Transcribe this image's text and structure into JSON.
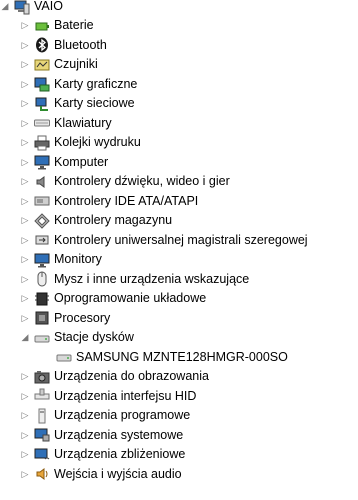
{
  "root": {
    "label": "VAIO",
    "icon": "computer-icon"
  },
  "categories": [
    {
      "label": "Baterie",
      "icon": "battery-icon",
      "expanded": false
    },
    {
      "label": "Bluetooth",
      "icon": "bluetooth-icon",
      "expanded": false
    },
    {
      "label": "Czujniki",
      "icon": "sensor-icon",
      "expanded": false
    },
    {
      "label": "Karty graficzne",
      "icon": "display-adapter-icon",
      "expanded": false
    },
    {
      "label": "Karty sieciowe",
      "icon": "network-adapter-icon",
      "expanded": false
    },
    {
      "label": "Klawiatury",
      "icon": "keyboard-icon",
      "expanded": false
    },
    {
      "label": "Kolejki wydruku",
      "icon": "printer-icon",
      "expanded": false
    },
    {
      "label": "Komputer",
      "icon": "monitor-icon",
      "expanded": false
    },
    {
      "label": "Kontrolery dźwięku, wideo i gier",
      "icon": "speaker-icon",
      "expanded": false
    },
    {
      "label": "Kontrolery IDE ATA/ATAPI",
      "icon": "ide-controller-icon",
      "expanded": false
    },
    {
      "label": "Kontrolery magazynu",
      "icon": "storage-controller-icon",
      "expanded": false
    },
    {
      "label": "Kontrolery uniwersalnej magistrali szeregowej",
      "icon": "usb-icon",
      "expanded": false
    },
    {
      "label": "Monitory",
      "icon": "monitor-icon",
      "expanded": false
    },
    {
      "label": "Mysz i inne urządzenia wskazujące",
      "icon": "mouse-icon",
      "expanded": false
    },
    {
      "label": "Oprogramowanie układowe",
      "icon": "firmware-icon",
      "expanded": false
    },
    {
      "label": "Procesory",
      "icon": "processor-icon",
      "expanded": false
    },
    {
      "label": "Stacje dysków",
      "icon": "disk-drive-icon",
      "expanded": true,
      "children": [
        {
          "label": "SAMSUNG MZNTE128HMGR-000SO",
          "icon": "disk-drive-icon"
        }
      ]
    },
    {
      "label": "Urządzenia do obrazowania",
      "icon": "camera-icon",
      "expanded": false
    },
    {
      "label": "Urządzenia interfejsu HID",
      "icon": "hid-icon",
      "expanded": false
    },
    {
      "label": "Urządzenia programowe",
      "icon": "software-device-icon",
      "expanded": false
    },
    {
      "label": "Urządzenia systemowe",
      "icon": "system-device-icon",
      "expanded": false
    },
    {
      "label": "Urządzenia zbliżeniowe",
      "icon": "proximity-icon",
      "expanded": false
    },
    {
      "label": "Wejścia i wyjścia audio",
      "icon": "audio-io-icon",
      "expanded": false
    }
  ]
}
